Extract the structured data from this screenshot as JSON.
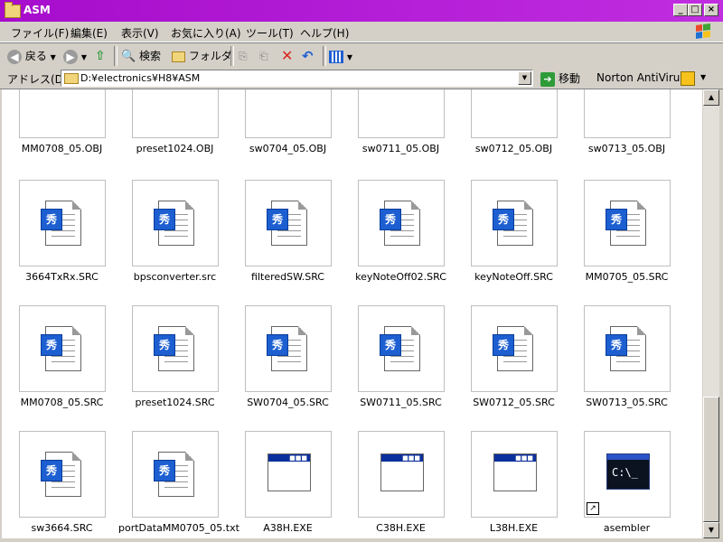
{
  "window": {
    "title": "ASM",
    "accent": "#a60ccc"
  },
  "menu": [
    "ファイル(F)",
    "編集(E)",
    "表示(V)",
    "お気に入り(A)",
    "ツール(T)",
    "ヘルプ(H)"
  ],
  "toolbar": {
    "back": "戻る",
    "search": "検索",
    "folders": "フォルダ"
  },
  "address": {
    "label": "アドレス(D)",
    "value": "D:¥electronics¥H8¥ASM",
    "go": "移動",
    "link": "Norton AntiVirus"
  },
  "files": {
    "row1": [
      "MM0708_05.OBJ",
      "preset1024.OBJ",
      "sw0704_05.OBJ",
      "sw0711_05.OBJ",
      "sw0712_05.OBJ",
      "sw0713_05.OBJ"
    ],
    "row2": [
      "3664TxRx.SRC",
      "bpsconverter.src",
      "filteredSW.SRC",
      "keyNoteOff02.SRC",
      "keyNoteOff.SRC",
      "MM0705_05.SRC"
    ],
    "row3": [
      "MM0708_05.SRC",
      "preset1024.SRC",
      "SW0704_05.SRC",
      "SW0711_05.SRC",
      "SW0712_05.SRC",
      "SW0713_05.SRC"
    ],
    "row4": [
      "sw3664.SRC",
      "portDataMM0705_05.txt",
      "A38H.EXE",
      "C38H.EXE",
      "L38H.EXE",
      "asembler"
    ]
  },
  "icons": {
    "src_badge": "秀",
    "cmd_prompt": "C:\\_"
  }
}
